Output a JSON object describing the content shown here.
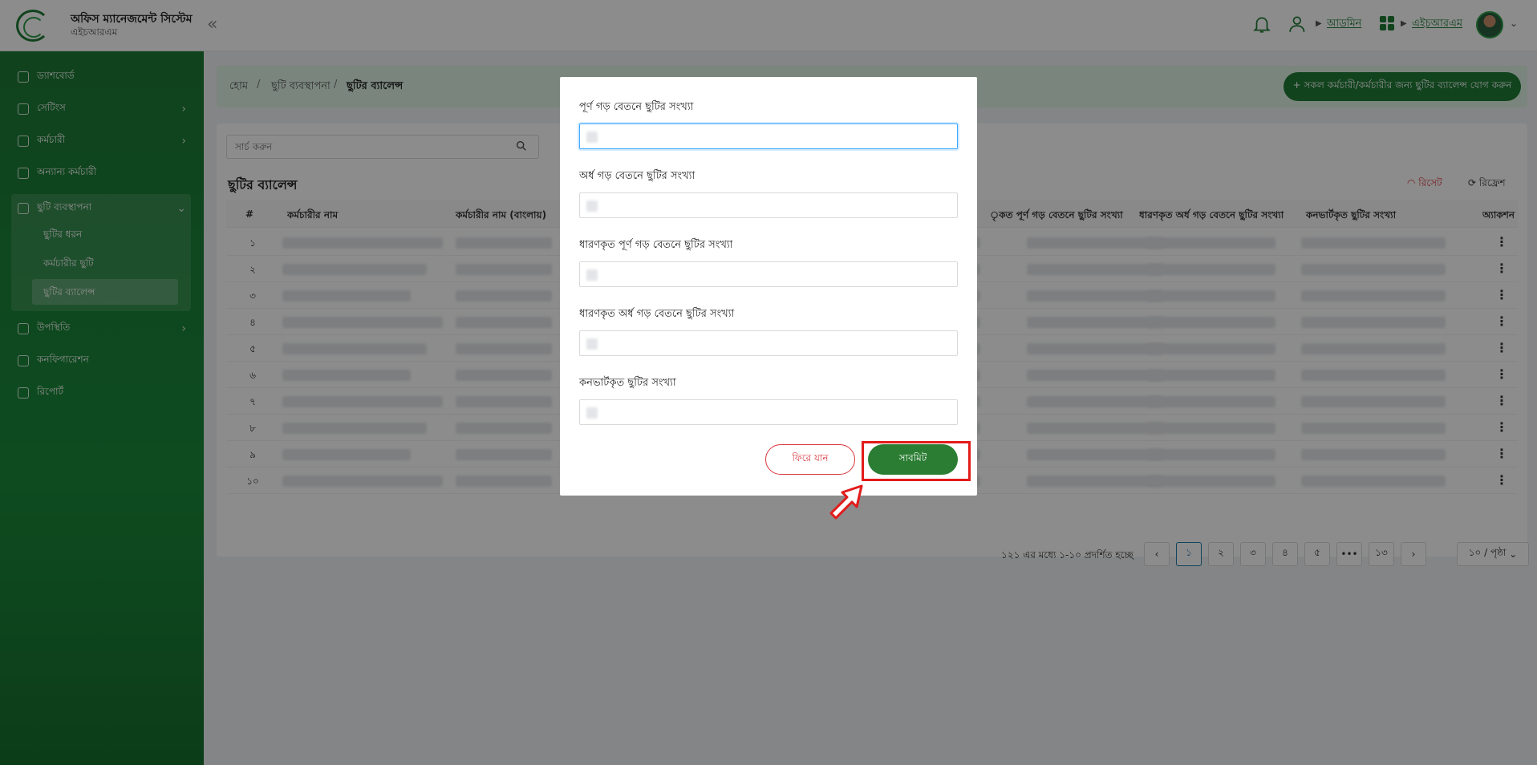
{
  "header": {
    "app_title": "অফিস ম্যানেজমেন্ট সিস্টেম",
    "app_subtitle": "এইচআরএম",
    "admin_label": "আডমিন",
    "hrm_label": "এইচআরএম"
  },
  "sidebar": {
    "items": [
      {
        "label": "ড্যাশবোর্ড",
        "icon": "dashboard-icon"
      },
      {
        "label": "সেটিংস",
        "icon": "gear-icon"
      },
      {
        "label": "কর্মচারী",
        "icon": "users-icon"
      },
      {
        "label": "অন্যান্য কর্মচারী",
        "icon": "users-icon"
      },
      {
        "label": "ছুটি ব্যবস্থাপনা",
        "icon": "leave-icon"
      },
      {
        "label": "উপস্থিতি",
        "icon": "clock-icon"
      },
      {
        "label": "কনফিগারেশন",
        "icon": "sliders-icon"
      },
      {
        "label": "রিপোর্ট",
        "icon": "report-icon"
      }
    ],
    "sub_items": [
      "ছুটির ধরন",
      "কর্মচারীর ছুটি",
      "ছুটির ব্যালেন্স"
    ]
  },
  "breadcrumb": [
    "হোম",
    "ছুটি ব্যবস্থাপনা",
    "ছুটির ব্যালেন্স"
  ],
  "add_button": "+ সকল কর্মচারী/কর্মচারীর জন্য ছুটির ব্যালেন্স যোগ করুন",
  "search": {
    "placeholder": "সার্চ করুন"
  },
  "card_title": "ছুটির ব্যালেন্স",
  "reset_label": "রিসেট",
  "refresh_label": "রিফ্রেশ",
  "table": {
    "headers": [
      "#",
      "কর্মচারীর নাম",
      "কর্মচারীর নাম (বাংলায়)",
      "ৃকত পূর্ণ গড় বেতনে ছুটির সংখ্যা",
      "ধারণকৃত অর্ধ গড় বেতনে ছুটির সংখ্যা",
      "কনভার্টকৃত ছুটির সংখ্যা",
      "অ্যাকশন"
    ],
    "rows": [
      "১",
      "২",
      "৩",
      "৪",
      "৫",
      "৬",
      "৭",
      "৮",
      "৯",
      "১০"
    ]
  },
  "pagination": {
    "info": "১২১ এর মধ্যে ১-১০ প্রদর্শিত হচ্ছে",
    "pages": [
      "১",
      "২",
      "৩",
      "৪",
      "৫",
      "•••",
      "১৩"
    ],
    "per_page": "১০ / পৃষ্ঠা"
  },
  "modal": {
    "fields": [
      {
        "label": "পূর্ণ গড় বেতনে ছুটির সংখ্যা"
      },
      {
        "label": "অর্ধ গড় বেতনে ছুটির সংখ্যা"
      },
      {
        "label": "ধারণকৃত পূর্ণ গড় বেতনে ছুটির সংখ্যা"
      },
      {
        "label": "ধারণকৃত অর্ধ গড় বেতনে ছুটির সংখ্যা"
      },
      {
        "label": "কনভার্টকৃত ছুটির সংখ্যা"
      }
    ],
    "back_label": "ফিরে যান",
    "submit_label": "সাবমিট"
  },
  "colors": {
    "brand": "#1f7a35",
    "highlight": "#e21b1b"
  }
}
